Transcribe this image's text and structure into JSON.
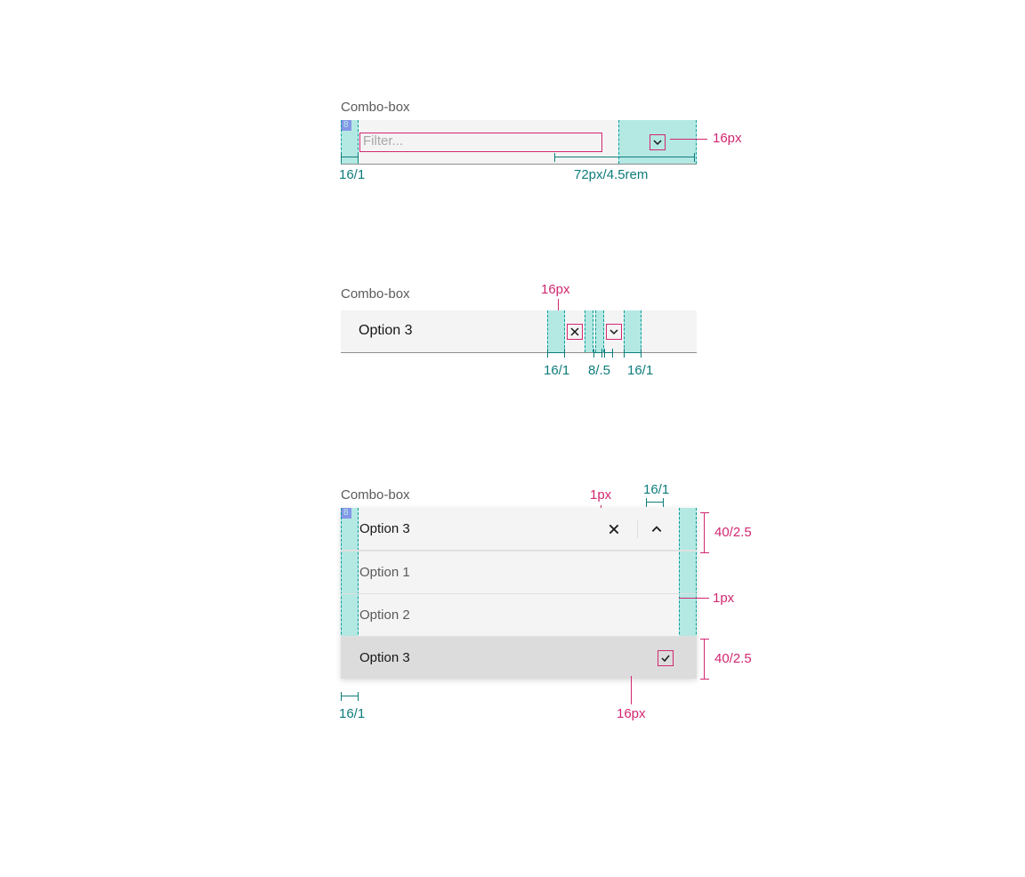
{
  "spec1": {
    "label": "Combo-box",
    "tag": "8",
    "placeholder": "Filter...",
    "icon_annotation": "16px",
    "left_pad": "16/1",
    "right_pad": "72px/4.5rem"
  },
  "spec2": {
    "label": "Combo-box",
    "value": "Option 3",
    "icon_annotation": "16px",
    "dims": [
      "16/1",
      "8/.5",
      "16/1"
    ]
  },
  "spec3": {
    "label": "Combo-box",
    "tag": "8",
    "header_value": "Option 3",
    "options": [
      "Option 1",
      "Option 2",
      "Option 3"
    ],
    "top_dim": "16/1",
    "left_dim": "16/1",
    "border_annotation": "1px",
    "divider_annotation": "1px",
    "row_height": "40/2.5",
    "check_annotation": "16px"
  }
}
